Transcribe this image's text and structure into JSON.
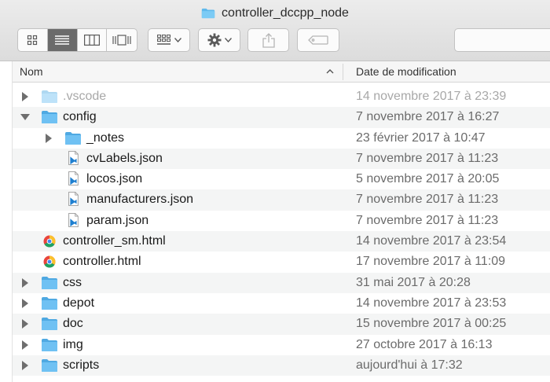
{
  "window": {
    "title": "controller_dccpp_node"
  },
  "toolbar": {
    "view_modes": [
      "icon-view",
      "list-view",
      "column-view",
      "cover-flow-view"
    ],
    "active_view": "list-view"
  },
  "columns": {
    "name": "Nom",
    "date": "Date de modification"
  },
  "files": [
    {
      "name": ".vscode",
      "date": "14 novembre 2017 à 23:39",
      "type": "folder",
      "expanded": false,
      "level": 0,
      "dim": true
    },
    {
      "name": "config",
      "date": "7 novembre 2017 à 16:27",
      "type": "folder",
      "expanded": true,
      "level": 0
    },
    {
      "name": "_notes",
      "date": "23 février 2017 à 10:47",
      "type": "folder",
      "expanded": false,
      "level": 1
    },
    {
      "name": "cvLabels.json",
      "date": "7 novembre 2017 à 11:23",
      "type": "json",
      "level": 1
    },
    {
      "name": "locos.json",
      "date": "5 novembre 2017 à 20:05",
      "type": "json",
      "level": 1
    },
    {
      "name": "manufacturers.json",
      "date": "7 novembre 2017 à 11:23",
      "type": "json",
      "level": 1
    },
    {
      "name": "param.json",
      "date": "7 novembre 2017 à 11:23",
      "type": "json",
      "level": 1
    },
    {
      "name": "controller_sm.html",
      "date": "14 novembre 2017 à 23:54",
      "type": "html",
      "level": 0
    },
    {
      "name": "controller.html",
      "date": "17 novembre 2017 à 11:09",
      "type": "html",
      "level": 0
    },
    {
      "name": "css",
      "date": "31 mai 2017 à 20:28",
      "type": "folder",
      "expanded": false,
      "level": 0
    },
    {
      "name": "depot",
      "date": "14 novembre 2017 à 23:53",
      "type": "folder",
      "expanded": false,
      "level": 0
    },
    {
      "name": "doc",
      "date": "15 novembre 2017 à 00:25",
      "type": "folder",
      "expanded": false,
      "level": 0
    },
    {
      "name": "img",
      "date": "27 octobre 2017 à 16:13",
      "type": "folder",
      "expanded": false,
      "level": 0
    },
    {
      "name": "scripts",
      "date": "aujourd'hui à 17:32",
      "type": "folder",
      "expanded": false,
      "level": 0
    }
  ]
}
